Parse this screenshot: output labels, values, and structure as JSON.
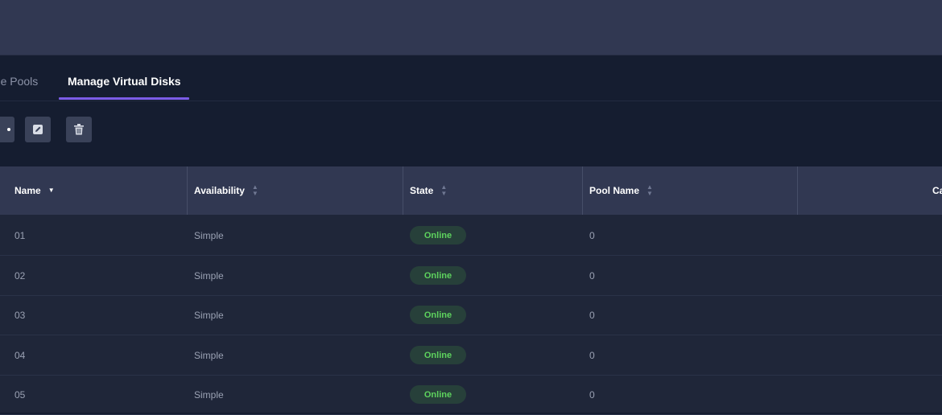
{
  "tabs": [
    {
      "label": "Manage Storage Pools",
      "visible_label": "age Pools",
      "active": false
    },
    {
      "label": "Manage Virtual Disks",
      "active": true
    }
  ],
  "toolbar": {
    "buttons": [
      {
        "name": "cut-off-button",
        "icon": "partial-icon"
      },
      {
        "name": "edit-button",
        "icon": "pencil-icon"
      },
      {
        "name": "delete-button",
        "icon": "trash-icon"
      }
    ]
  },
  "table": {
    "columns": [
      {
        "label": "Name",
        "sort": "descending"
      },
      {
        "label": "Availability",
        "sort": "none"
      },
      {
        "label": "State",
        "sort": "none"
      },
      {
        "label": "Pool Name",
        "sort": "none"
      },
      {
        "label": "Ca",
        "sort": "none"
      }
    ],
    "rows": [
      {
        "name": "01",
        "availability": "Simple",
        "state": "Online",
        "pool_name": "0"
      },
      {
        "name": "02",
        "availability": "Simple",
        "state": "Online",
        "pool_name": "0"
      },
      {
        "name": "03",
        "availability": "Simple",
        "state": "Online",
        "pool_name": "0"
      },
      {
        "name": "04",
        "availability": "Simple",
        "state": "Online",
        "pool_name": "0"
      },
      {
        "name": "05",
        "availability": "Simple",
        "state": "Online",
        "pool_name": "0"
      }
    ]
  },
  "colors": {
    "accent": "#7b5ce6",
    "online_text": "#5ed35e",
    "online_bg": "#27403a",
    "header_bg": "#313852"
  }
}
